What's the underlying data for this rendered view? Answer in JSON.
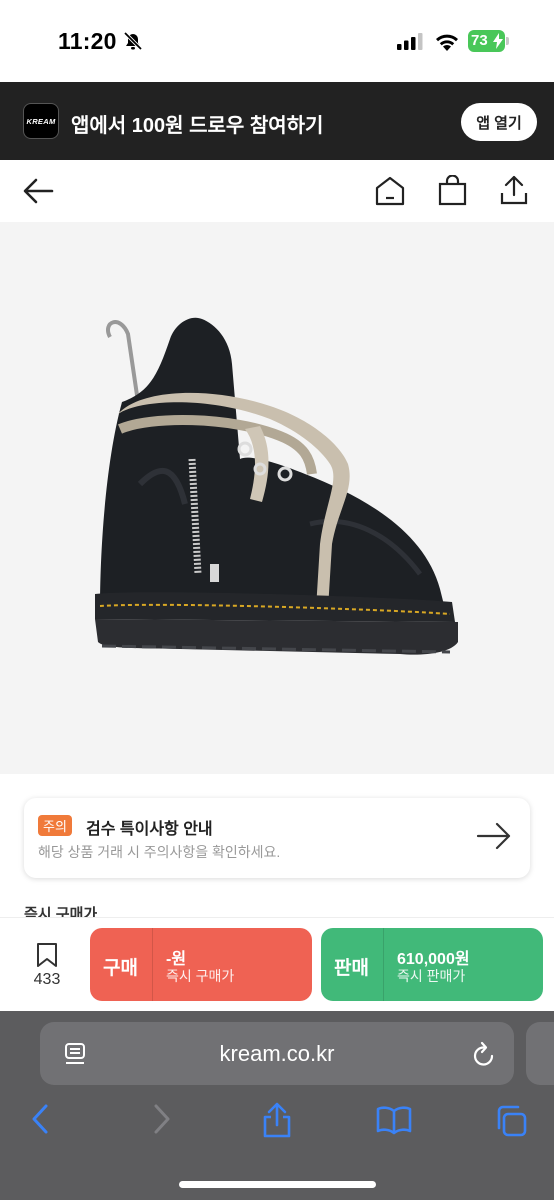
{
  "status_bar": {
    "time": "11:20",
    "battery": "73"
  },
  "app_banner": {
    "logo_text": "KREAM",
    "text": "앱에서 100원 드로우 참여하기",
    "button": "앱 열기"
  },
  "notice": {
    "tag": "주의",
    "title": "검수 특이사항 안내",
    "description": "해당 상품 거래 시 주의사항을 확인하세요."
  },
  "partial_heading": "즉시 구매가",
  "wishlist": {
    "count": "433"
  },
  "buy": {
    "label": "구매",
    "price": "-원",
    "sub": "즉시 구매가"
  },
  "sell": {
    "label": "판매",
    "price": "610,000원",
    "sub": "즉시 판매가"
  },
  "browser": {
    "url": "kream.co.kr"
  },
  "colors": {
    "buy": "#ef6253",
    "sell": "#41b979",
    "notice_tag": "#f07a3a",
    "banner_bg": "#222222",
    "safari_accent": "#3a82f7"
  },
  "icons": [
    "bell-slash-icon",
    "signal-icon",
    "wifi-icon",
    "battery-icon",
    "back-arrow-icon",
    "home-icon",
    "shopping-bag-icon",
    "share-icon",
    "arrow-right-icon",
    "bookmark-icon",
    "reader-icon",
    "reload-icon",
    "safari-back-icon",
    "safari-forward-icon",
    "safari-share-icon",
    "bookmarks-icon",
    "tabs-icon"
  ]
}
